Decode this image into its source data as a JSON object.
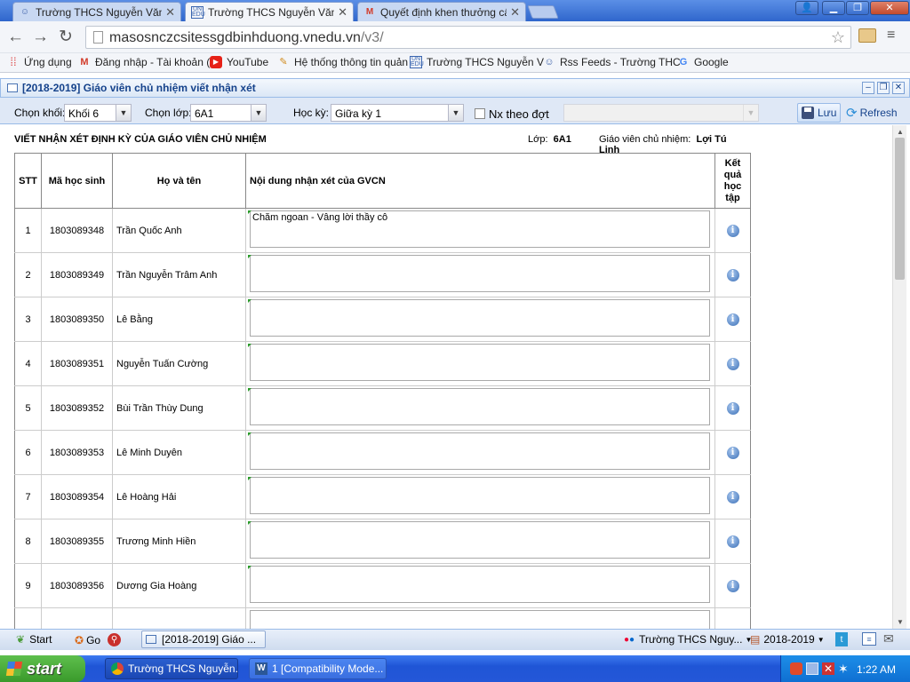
{
  "browser": {
    "tabs": [
      {
        "title": "Trường THCS Nguyễn Văn Cừ",
        "icon": "rss-person-icon",
        "active": false
      },
      {
        "title": "Trường THCS Nguyễn Văn Cừ",
        "icon": "vnedu-icon",
        "active": true
      },
      {
        "title": "Quyết định khen thưởng cấp",
        "icon": "gmail-icon",
        "active": false
      }
    ],
    "url_host": "masosnczcsitessgdbinhduong.vnedu.vn",
    "url_path": "/v3/",
    "bookmarks": [
      {
        "label": "Ứng dụng",
        "icon": "apps-grid-icon"
      },
      {
        "label": "Đăng nhập - Tài khoản (",
        "icon": "gmail-icon"
      },
      {
        "label": "YouTube",
        "icon": "youtube-icon"
      },
      {
        "label": "Hệ thống thông tin quản",
        "icon": "pencil-icon"
      },
      {
        "label": "Trường THCS Nguyễn V",
        "icon": "vnedu-icon"
      },
      {
        "label": "Rss Feeds - Trường THC",
        "icon": "rss-person-icon"
      },
      {
        "label": "Google",
        "icon": "google-icon"
      }
    ]
  },
  "panel": {
    "title": "[2018-2019] Giáo viên chủ nhiệm viết nhận xét",
    "filters": {
      "khoi_label": "Chọn khối:",
      "khoi_value": "Khối 6",
      "lop_label": "Chọn lớp:",
      "lop_value": "6A1",
      "hocky_label": "Học kỳ:",
      "hocky_value": "Giữa kỳ 1",
      "nx_label": "Nx theo đợt",
      "save_label": "Lưu",
      "refresh_label": "Refresh"
    },
    "heading": "VIẾT NHẬN XÉT ĐỊNH KỲ CỦA GIÁO VIÊN CHỦ NHIỆM",
    "class_label": "Lớp:",
    "class_value": "6A1",
    "teacher_label": "Giáo viên chủ nhiệm:",
    "teacher_value": "Lợi Tú Linh",
    "columns": [
      "STT",
      "Mã học sinh",
      "Họ và tên",
      "Nội dung nhận xét của GVCN",
      "Kết quả học tập"
    ],
    "rows": [
      {
        "stt": "1",
        "ma": "1803089348",
        "ten": "Trần Quốc Anh",
        "nhanxet": "Chăm ngoan - Vâng lời thầy cô"
      },
      {
        "stt": "2",
        "ma": "1803089349",
        "ten": "Trần Nguyễn Trâm Anh",
        "nhanxet": ""
      },
      {
        "stt": "3",
        "ma": "1803089350",
        "ten": "Lê Bằng",
        "nhanxet": ""
      },
      {
        "stt": "4",
        "ma": "1803089351",
        "ten": "Nguyễn Tuấn Cường",
        "nhanxet": ""
      },
      {
        "stt": "5",
        "ma": "1803089352",
        "ten": "Bùi Trần Thùy Dung",
        "nhanxet": ""
      },
      {
        "stt": "6",
        "ma": "1803089353",
        "ten": "Lê Minh Duyên",
        "nhanxet": ""
      },
      {
        "stt": "7",
        "ma": "1803089354",
        "ten": "Lê Hoàng Hải",
        "nhanxet": ""
      },
      {
        "stt": "8",
        "ma": "1803089355",
        "ten": "Trương Minh Hiền",
        "nhanxet": ""
      },
      {
        "stt": "9",
        "ma": "1803089356",
        "ten": "Dương Gia Hoàng",
        "nhanxet": ""
      }
    ]
  },
  "ext_taskbar": {
    "start_label": "Start",
    "go_label": "Go",
    "window_label": "[2018-2019] Giáo ...",
    "school_label": "Trường THCS Nguy...",
    "year_label": "2018-2019"
  },
  "win_taskbar": {
    "start_label": "start",
    "items": [
      {
        "label": "Trường THCS Nguyễn...",
        "icon": "chrome-icon"
      },
      {
        "label": "1 [Compatibility Mode...",
        "icon": "word-icon"
      }
    ],
    "clock": "1:22 AM"
  },
  "colors": {
    "ext_header_text": "#15428b",
    "ext_border": "#99bbe8",
    "xp_taskbar": "#2457d8",
    "xp_start": "#3a9a2b"
  }
}
